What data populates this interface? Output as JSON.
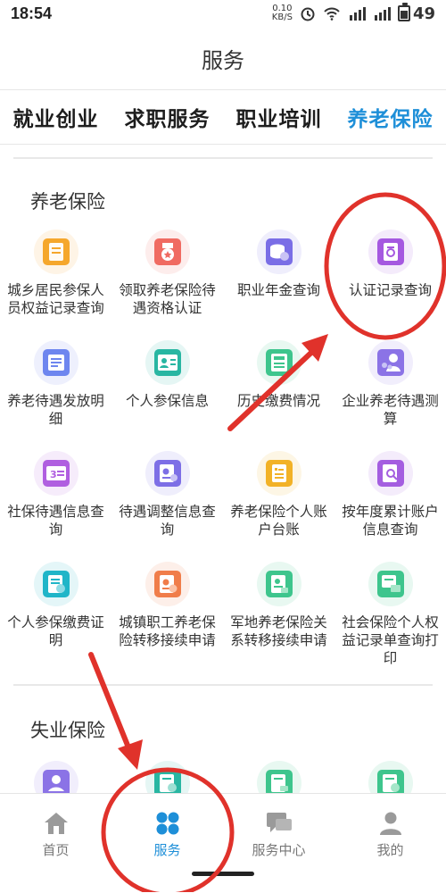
{
  "status": {
    "time": "18:54",
    "speed_top": "0.10",
    "speed_bottom": "KB/S",
    "battery": "49"
  },
  "title": "服务",
  "tabs": [
    {
      "label": "就业创业",
      "active": false
    },
    {
      "label": "求职服务",
      "active": false
    },
    {
      "label": "职业培训",
      "active": false
    },
    {
      "label": "养老保险",
      "active": true
    }
  ],
  "sections": {
    "pension": {
      "title": "养老保险",
      "items": [
        {
          "label": "城乡居民参保人员权益记录查询",
          "icon": "document-icon",
          "color": "#f5a72c"
        },
        {
          "label": "领取养老保险待遇资格认证",
          "icon": "medal-icon",
          "color": "#f06b62"
        },
        {
          "label": "职业年金查询",
          "icon": "coins-icon",
          "color": "#7a6ee6"
        },
        {
          "label": "认证记录查询",
          "icon": "certificate-icon",
          "color": "#a558e0"
        },
        {
          "label": "养老待遇发放明细",
          "icon": "list-icon",
          "color": "#6e86ef"
        },
        {
          "label": "个人参保信息",
          "icon": "id-card-icon",
          "color": "#28b6a2"
        },
        {
          "label": "历史缴费情况",
          "icon": "receipt-icon",
          "color": "#3ec58d"
        },
        {
          "label": "企业养老待遇测算",
          "icon": "people-icon",
          "color": "#8b73e6"
        },
        {
          "label": "社保待遇信息查询",
          "icon": "card-icon",
          "color": "#b05fe0"
        },
        {
          "label": "待遇调整信息查询",
          "icon": "adjust-icon",
          "color": "#7d6fe6"
        },
        {
          "label": "养老保险个人账户台账",
          "icon": "ledger-icon",
          "color": "#f2b227"
        },
        {
          "label": "按年度累计账户信息查询",
          "icon": "search-doc-icon",
          "color": "#a45ee0"
        },
        {
          "label": "个人参保缴费证明",
          "icon": "proof-icon",
          "color": "#20b5c8"
        },
        {
          "label": "城镇职工养老保险转移接续申请",
          "icon": "transfer-icon",
          "color": "#f07d4a"
        },
        {
          "label": "军地养老保险关系转移接续申请",
          "icon": "transfer-doc-icon",
          "color": "#3ec58d"
        },
        {
          "label": "社会保险个人权益记录单查询打印",
          "icon": "print-icon",
          "color": "#3ec58d"
        }
      ]
    },
    "unemployment": {
      "title": "失业保险",
      "items": [
        {
          "icon": "user-hand-icon",
          "color": "#8b73e6"
        },
        {
          "icon": "doc-plus-icon",
          "color": "#28b6a2"
        },
        {
          "icon": "doc-car-icon",
          "color": "#3ec58d"
        },
        {
          "icon": "doc-check-icon",
          "color": "#3ec58d"
        }
      ]
    }
  },
  "nav": [
    {
      "label": "首页",
      "icon": "home-icon",
      "active": false
    },
    {
      "label": "服务",
      "icon": "grid-icon",
      "active": true
    },
    {
      "label": "服务中心",
      "icon": "chat-icon",
      "active": false
    },
    {
      "label": "我的",
      "icon": "user-icon",
      "active": false
    }
  ],
  "annotation_color": "#e0322b"
}
